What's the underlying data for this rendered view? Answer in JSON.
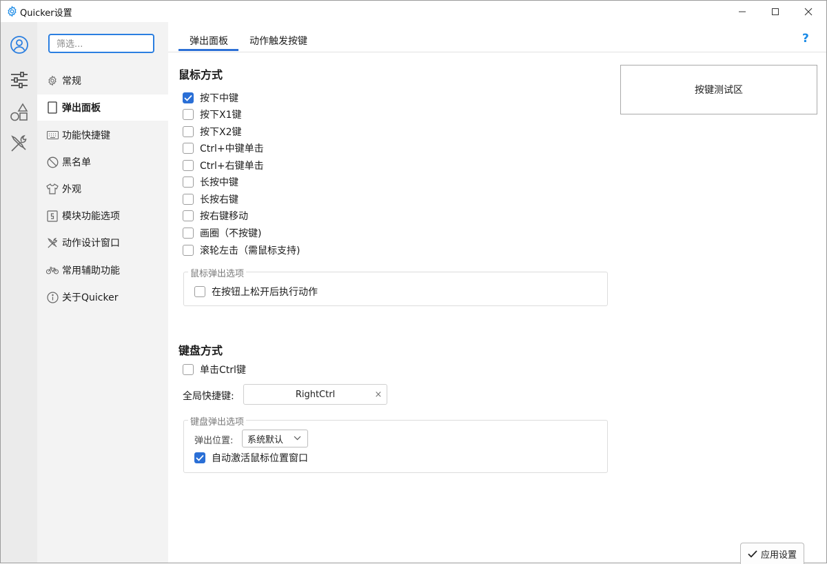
{
  "window": {
    "title": "Quicker设置"
  },
  "rail": {
    "items": [
      "user-icon",
      "sliders-icon",
      "shapes-icon",
      "tools-icon"
    ]
  },
  "nav": {
    "filter_placeholder": "筛选...",
    "items": [
      {
        "label": "常规",
        "icon": "gear-icon",
        "active": false
      },
      {
        "label": "弹出面板",
        "icon": "panel-icon",
        "active": true
      },
      {
        "label": "功能快捷键",
        "icon": "keyboard-icon",
        "active": false
      },
      {
        "label": "黑名单",
        "icon": "forbidden-icon",
        "active": false
      },
      {
        "label": "外观",
        "icon": "tshirt-icon",
        "active": false
      },
      {
        "label": "模块功能选项",
        "icon": "module-icon",
        "active": false
      },
      {
        "label": "动作设计窗口",
        "icon": "tools-icon",
        "active": false
      },
      {
        "label": "常用辅助功能",
        "icon": "bike-icon",
        "active": false
      },
      {
        "label": "关于Quicker",
        "icon": "info-icon",
        "active": false
      }
    ]
  },
  "tabs": [
    {
      "label": "弹出面板",
      "active": true
    },
    {
      "label": "动作触发按键",
      "active": false
    }
  ],
  "help_label": "?",
  "mouse": {
    "title": "鼠标方式",
    "options": [
      {
        "label": "按下中键",
        "checked": true
      },
      {
        "label": "按下X1键",
        "checked": false
      },
      {
        "label": "按下X2键",
        "checked": false
      },
      {
        "label": "Ctrl+中键单击",
        "checked": false
      },
      {
        "label": "Ctrl+右键单击",
        "checked": false
      },
      {
        "label": "长按中键",
        "checked": false
      },
      {
        "label": "长按右键",
        "checked": false
      },
      {
        "label": "按右键移动",
        "checked": false
      },
      {
        "label": "画圈（不按键)",
        "checked": false
      },
      {
        "label": "滚轮左击（需鼠标支持)",
        "checked": false
      }
    ],
    "popup_group": {
      "legend": "鼠标弹出选项",
      "option": {
        "label": "在按钮上松开后执行动作",
        "checked": false
      }
    }
  },
  "keytest": {
    "label": "按键测试区"
  },
  "keyboard": {
    "title": "键盘方式",
    "single_ctrl": {
      "label": "单击Ctrl键",
      "checked": false
    },
    "hotkey_label": "全局快捷键:",
    "hotkey_value": "RightCtrl",
    "hotkey_clear": "×",
    "popup_group": {
      "legend": "键盘弹出选项",
      "position_label": "弹出位置:",
      "position_value": "系统默认",
      "auto_activate": {
        "label": "自动激活鼠标位置窗口",
        "checked": true
      }
    }
  },
  "apply_button": {
    "label": "应用设置"
  },
  "colors": {
    "accent": "#2a6fd6",
    "help": "#1a8ae6"
  }
}
